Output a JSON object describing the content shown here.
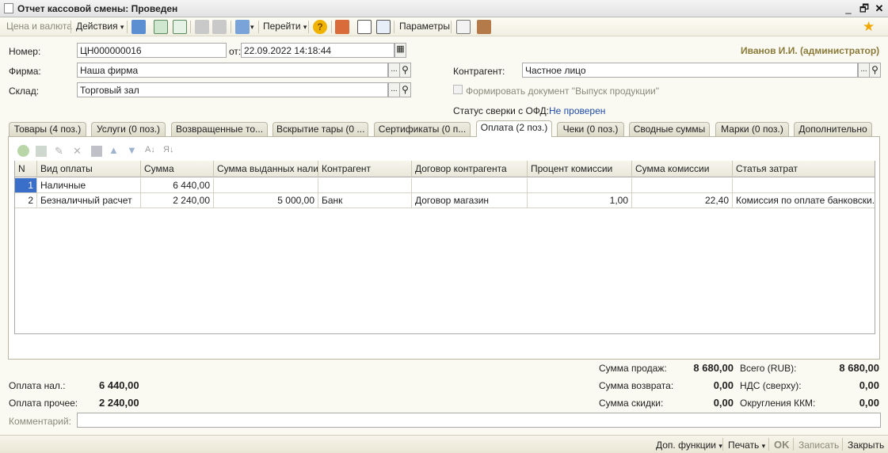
{
  "window": {
    "title": "Отчет кассовой смены: Проведен",
    "restore_glyph": "🗗",
    "minimize_glyph": "_",
    "close_glyph": "✕"
  },
  "toolbar": {
    "price_currency": "Цена и валюта",
    "actions": "Действия",
    "goto": "Перейти",
    "params": "Параметры",
    "dropdown_glyph": "▾",
    "help_glyph": "?",
    "star_glyph": "★"
  },
  "header": {
    "user": "Иванов И.И. (администратор)",
    "number_label": "Номер:",
    "number_value": "ЦН000000016",
    "date_label": "от:",
    "date_value": "22.09.2022 14:18:44",
    "firm_label": "Фирма:",
    "firm_value": "Наша фирма",
    "warehouse_label": "Склад:",
    "warehouse_value": "Торговый зал",
    "counterparty_label": "Контрагент:",
    "counterparty_value": "Частное лицо",
    "form_doc_label": "Формировать документ \"Выпуск продукции\"",
    "ofd_label": "Статус сверки с ОФД:",
    "ofd_value": "Не проверен",
    "ellipsis": "...",
    "search_glyph": "⚲"
  },
  "tabs": [
    {
      "label": "Товары (4 поз.)"
    },
    {
      "label": "Услуги (0 поз.)"
    },
    {
      "label": "Возвращенные то..."
    },
    {
      "label": "Вскрытие тары (0 ..."
    },
    {
      "label": "Сертификаты (0 п..."
    },
    {
      "label": "Оплата (2 поз.)",
      "active": true
    },
    {
      "label": "Чеки (0 поз.)"
    },
    {
      "label": "Сводные суммы"
    },
    {
      "label": "Марки (0 поз.)"
    },
    {
      "label": "Дополнительно"
    }
  ],
  "grid": {
    "columns": [
      "N",
      "Вид оплаты",
      "Сумма",
      "Сумма выданных нали...",
      "Контрагент",
      "Договор контрагента",
      "Процент комиссии",
      "Сумма комиссии",
      "Статья затрат"
    ],
    "rows": [
      [
        "1",
        "Наличные",
        "6 440,00",
        "",
        "",
        "",
        "",
        "",
        ""
      ],
      [
        "2",
        "Безналичный расчет",
        "2 240,00",
        "5 000,00",
        "Банк",
        "Договор магазин",
        "1,00",
        "22,40",
        "Комиссия по оплате банковски..."
      ]
    ]
  },
  "totals": {
    "sales_label": "Сумма продаж:",
    "sales_value": "8 680,00",
    "total_label": "Всего (RUB):",
    "total_value": "8 680,00",
    "return_label": "Сумма возврата:",
    "return_value": "0,00",
    "vat_label": "НДС (сверху):",
    "vat_value": "0,00",
    "discount_label": "Сумма скидки:",
    "discount_value": "0,00",
    "rounding_label": "Округления ККМ:",
    "rounding_value": "0,00",
    "cash_label": "Оплата нал.:",
    "cash_value": "6 440,00",
    "other_label": "Оплата прочее:",
    "other_value": "2 240,00",
    "comment_label": "Комментарий:"
  },
  "footer": {
    "extra_functions": "Доп. функции",
    "print": "Печать",
    "ok": "OK",
    "save": "Записать",
    "close": "Закрыть"
  }
}
